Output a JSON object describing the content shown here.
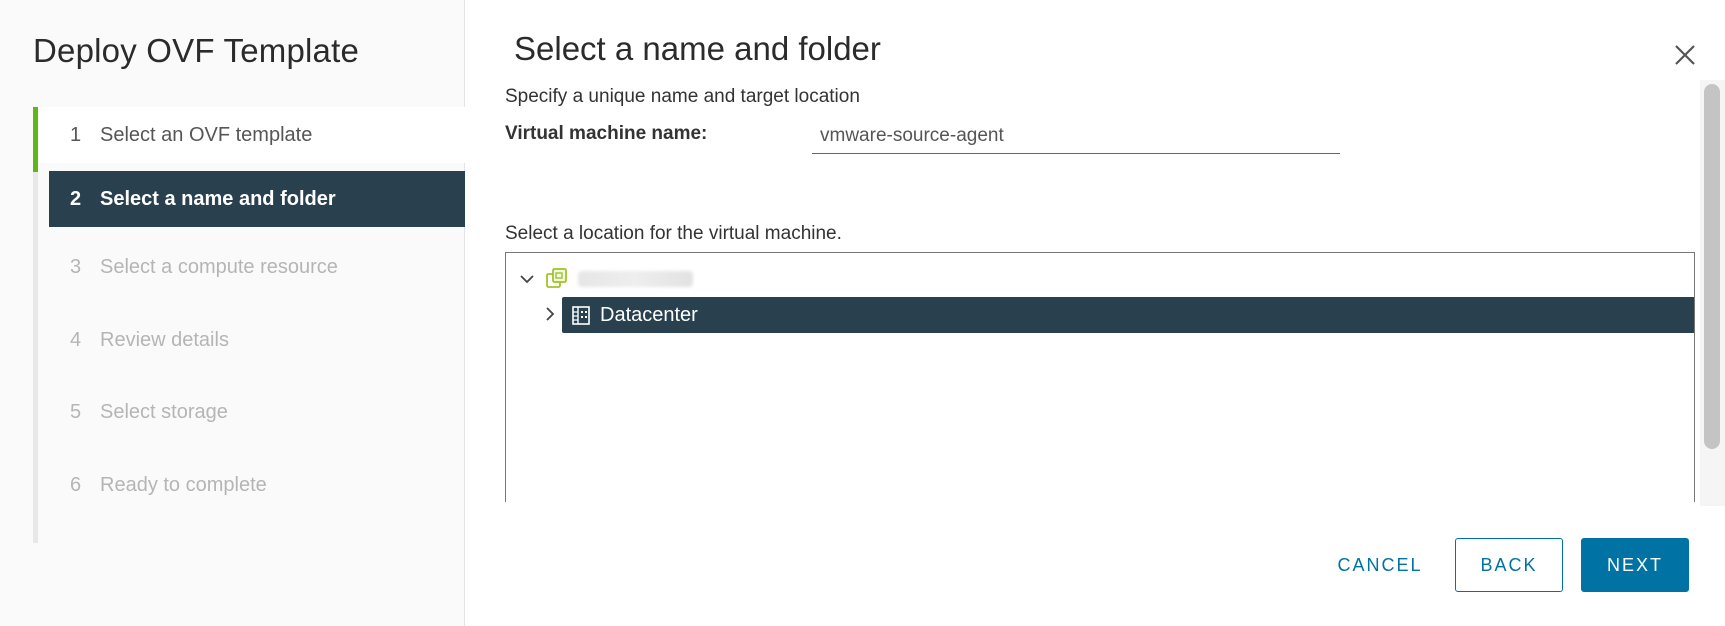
{
  "wizard": {
    "title": "Deploy OVF Template",
    "steps": [
      {
        "num": "1",
        "label": "Select an OVF template",
        "state": "done"
      },
      {
        "num": "2",
        "label": "Select a name and folder",
        "state": "active"
      },
      {
        "num": "3",
        "label": "Select a compute resource",
        "state": "disabled"
      },
      {
        "num": "4",
        "label": "Review details",
        "state": "disabled"
      },
      {
        "num": "5",
        "label": "Select storage",
        "state": "disabled"
      },
      {
        "num": "6",
        "label": "Ready to complete",
        "state": "disabled"
      }
    ]
  },
  "main": {
    "title": "Select a name and folder",
    "subtitle": "Specify a unique name and target location",
    "vm_name_label": "Virtual machine name:",
    "vm_name_value": "vmware-source-agent",
    "location_label": "Select a location for the virtual machine.",
    "tree": {
      "root": {
        "icon": "vcenter-icon",
        "expanded": true
      },
      "datacenter": {
        "label": "Datacenter",
        "icon": "datacenter-icon",
        "expanded": false,
        "selected": true
      }
    }
  },
  "footer": {
    "cancel": "CANCEL",
    "back": "BACK",
    "next": "NEXT"
  },
  "colors": {
    "accent": "#0072a3",
    "selected": "#29414e",
    "progress": "#5eb715"
  }
}
